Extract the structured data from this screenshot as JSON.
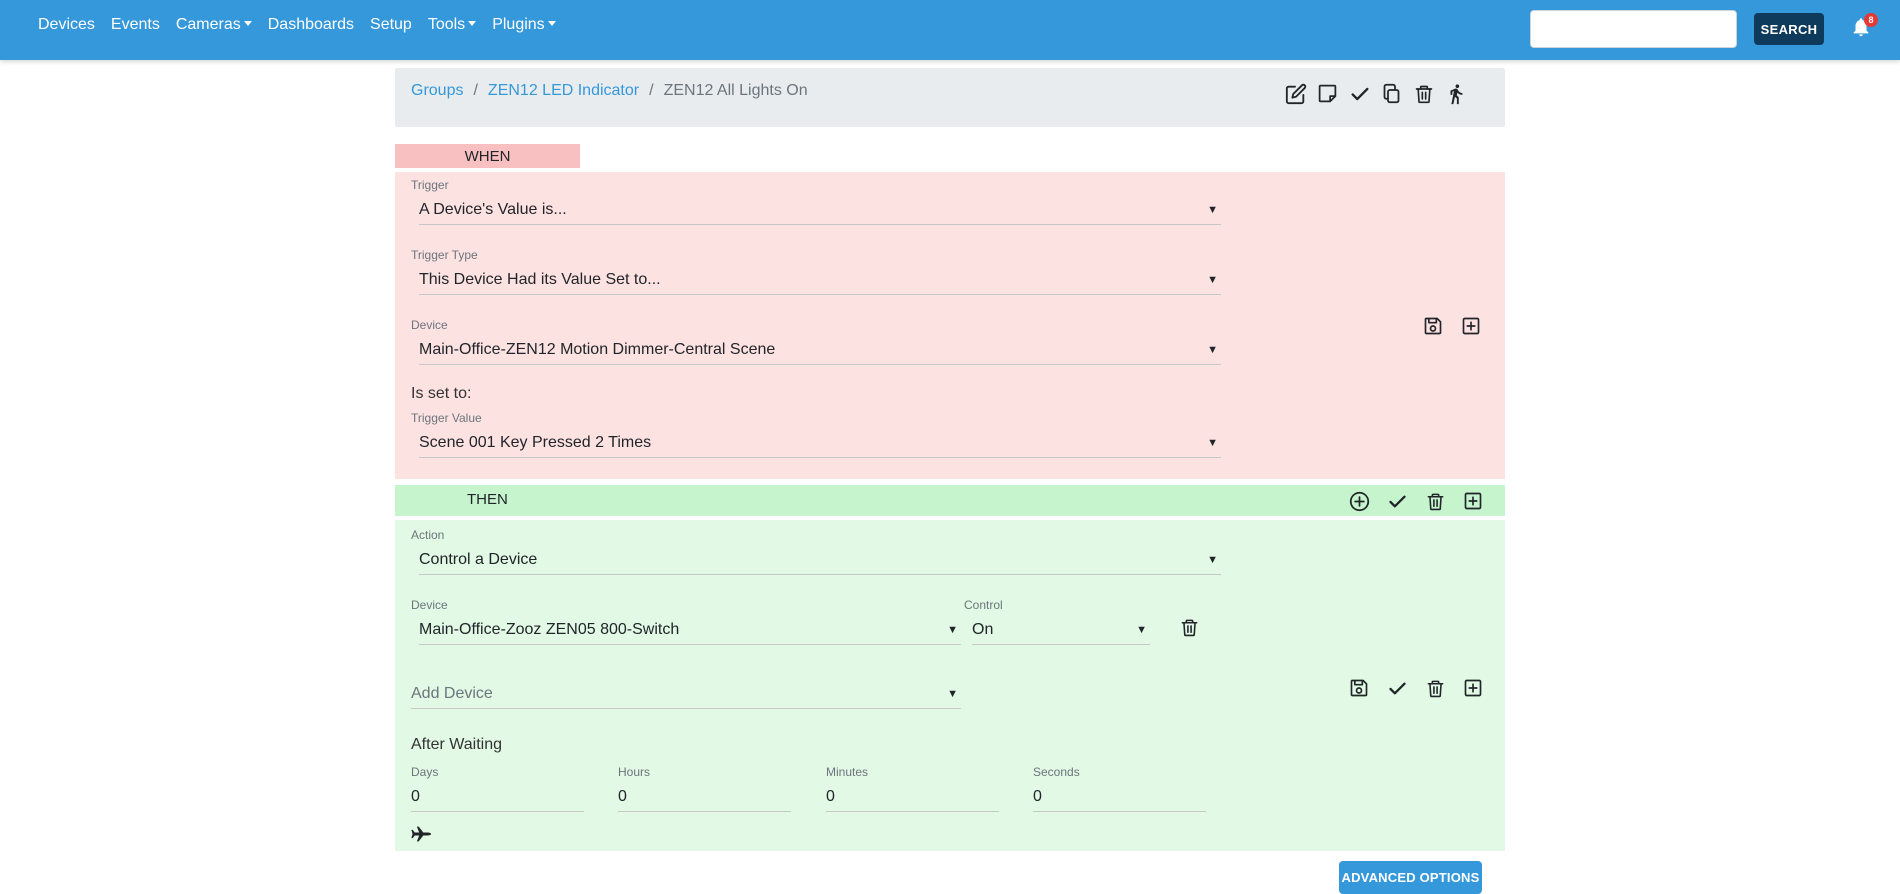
{
  "navbar": {
    "items": [
      {
        "label": "Devices",
        "dropdown": false
      },
      {
        "label": "Events",
        "dropdown": false
      },
      {
        "label": "Cameras",
        "dropdown": true
      },
      {
        "label": "Dashboards",
        "dropdown": false
      },
      {
        "label": "Setup",
        "dropdown": false
      },
      {
        "label": "Tools",
        "dropdown": true
      },
      {
        "label": "Plugins",
        "dropdown": true
      }
    ],
    "search_placeholder": "",
    "search_label": "SEARCH",
    "notification_count": "8",
    "color": "#3498db"
  },
  "breadcrumb": {
    "items": [
      "Groups",
      "ZEN12 LED Indicator"
    ],
    "current": "ZEN12 All Lights On",
    "toolbar_icons": [
      "edit-icon",
      "note-icon",
      "check-icon",
      "copy-icon",
      "trash-icon",
      "run-icon"
    ]
  },
  "when": {
    "tab_label": "WHEN",
    "trigger": {
      "label": "Trigger",
      "value": "A Device's Value is..."
    },
    "trigger_type": {
      "label": "Trigger Type",
      "value": "This Device Had its Value Set to..."
    },
    "device": {
      "label": "Device",
      "value": "Main-Office-ZEN12 Motion Dimmer-Central Scene"
    },
    "is_set_to": "Is set to:",
    "trigger_value": {
      "label": "Trigger Value",
      "value": "Scene 001 Key Pressed 2 Times"
    },
    "side_icons": [
      "save-icon",
      "add-box-icon"
    ],
    "color": "#fde2e2"
  },
  "then": {
    "label": "THEN",
    "bar_icons": [
      "add-circle-icon",
      "check-icon",
      "trash-icon",
      "add-box-icon"
    ],
    "action": {
      "label": "Action",
      "value": "Control a Device"
    },
    "device": {
      "label": "Device",
      "value": "Main-Office-Zooz ZEN05 800-Switch"
    },
    "control": {
      "label": "Control",
      "value": "On"
    },
    "add_device_placeholder": "Add Device",
    "after_waiting": "After Waiting",
    "wait": {
      "days": {
        "label": "Days",
        "value": "0"
      },
      "hours": {
        "label": "Hours",
        "value": "0"
      },
      "minutes": {
        "label": "Minutes",
        "value": "0"
      },
      "seconds": {
        "label": "Seconds",
        "value": "0"
      }
    },
    "side_icons": [
      "save-icon",
      "check-icon",
      "trash-icon",
      "add-box-icon"
    ],
    "color": "#e2f9e5"
  },
  "advanced_options_label": "ADVANCED OPTIONS"
}
